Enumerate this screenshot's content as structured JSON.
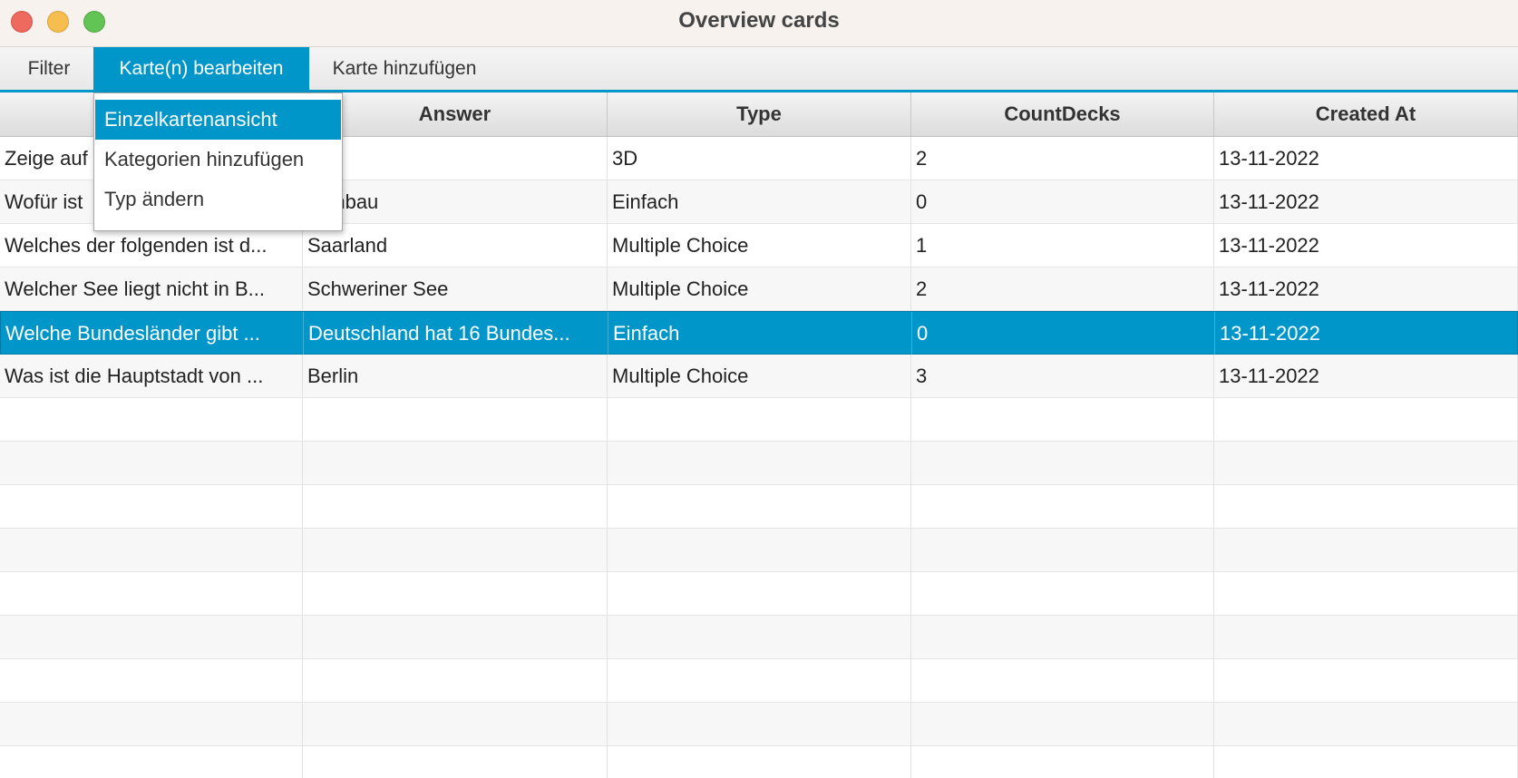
{
  "window": {
    "title": "Overview cards"
  },
  "menubar": {
    "items": [
      {
        "label": "Filter"
      },
      {
        "label": "Karte(n) bearbeiten"
      },
      {
        "label": "Karte hinzufügen"
      }
    ],
    "active_index": 1
  },
  "dropdown": {
    "items": [
      {
        "label": "Einzelkartenansicht"
      },
      {
        "label": "Kategorien hinzufügen"
      },
      {
        "label": "Typ ändern"
      }
    ],
    "highlighted_index": 0
  },
  "table": {
    "columns": [
      "",
      "Answer",
      "Type",
      "CountDecks",
      "Created At"
    ],
    "rows": [
      [
        "Zeige auf",
        "",
        "3D",
        "2",
        "13-11-2022"
      ],
      [
        "Wofür ist",
        "stanbau",
        "Einfach",
        "0",
        "13-11-2022"
      ],
      [
        "Welches der folgenden ist d...",
        "Saarland",
        "Multiple Choice",
        "1",
        "13-11-2022"
      ],
      [
        "Welcher See liegt nicht in B...",
        "Schweriner See",
        "Multiple Choice",
        "2",
        "13-11-2022"
      ],
      [
        "Welche Bundesländer gibt ...",
        "Deutschland hat 16 Bundes...",
        "Einfach",
        "0",
        "13-11-2022"
      ],
      [
        "Was ist die Hauptstadt von ...",
        "Berlin",
        "Multiple Choice",
        "3",
        "13-11-2022"
      ]
    ],
    "selected_row": 4
  },
  "colors": {
    "accent": "#0096c9",
    "titlebar_bg": "#f8f2ee",
    "close": "#ee6a5f",
    "minimize": "#f5be4f",
    "maximize": "#62c454"
  }
}
